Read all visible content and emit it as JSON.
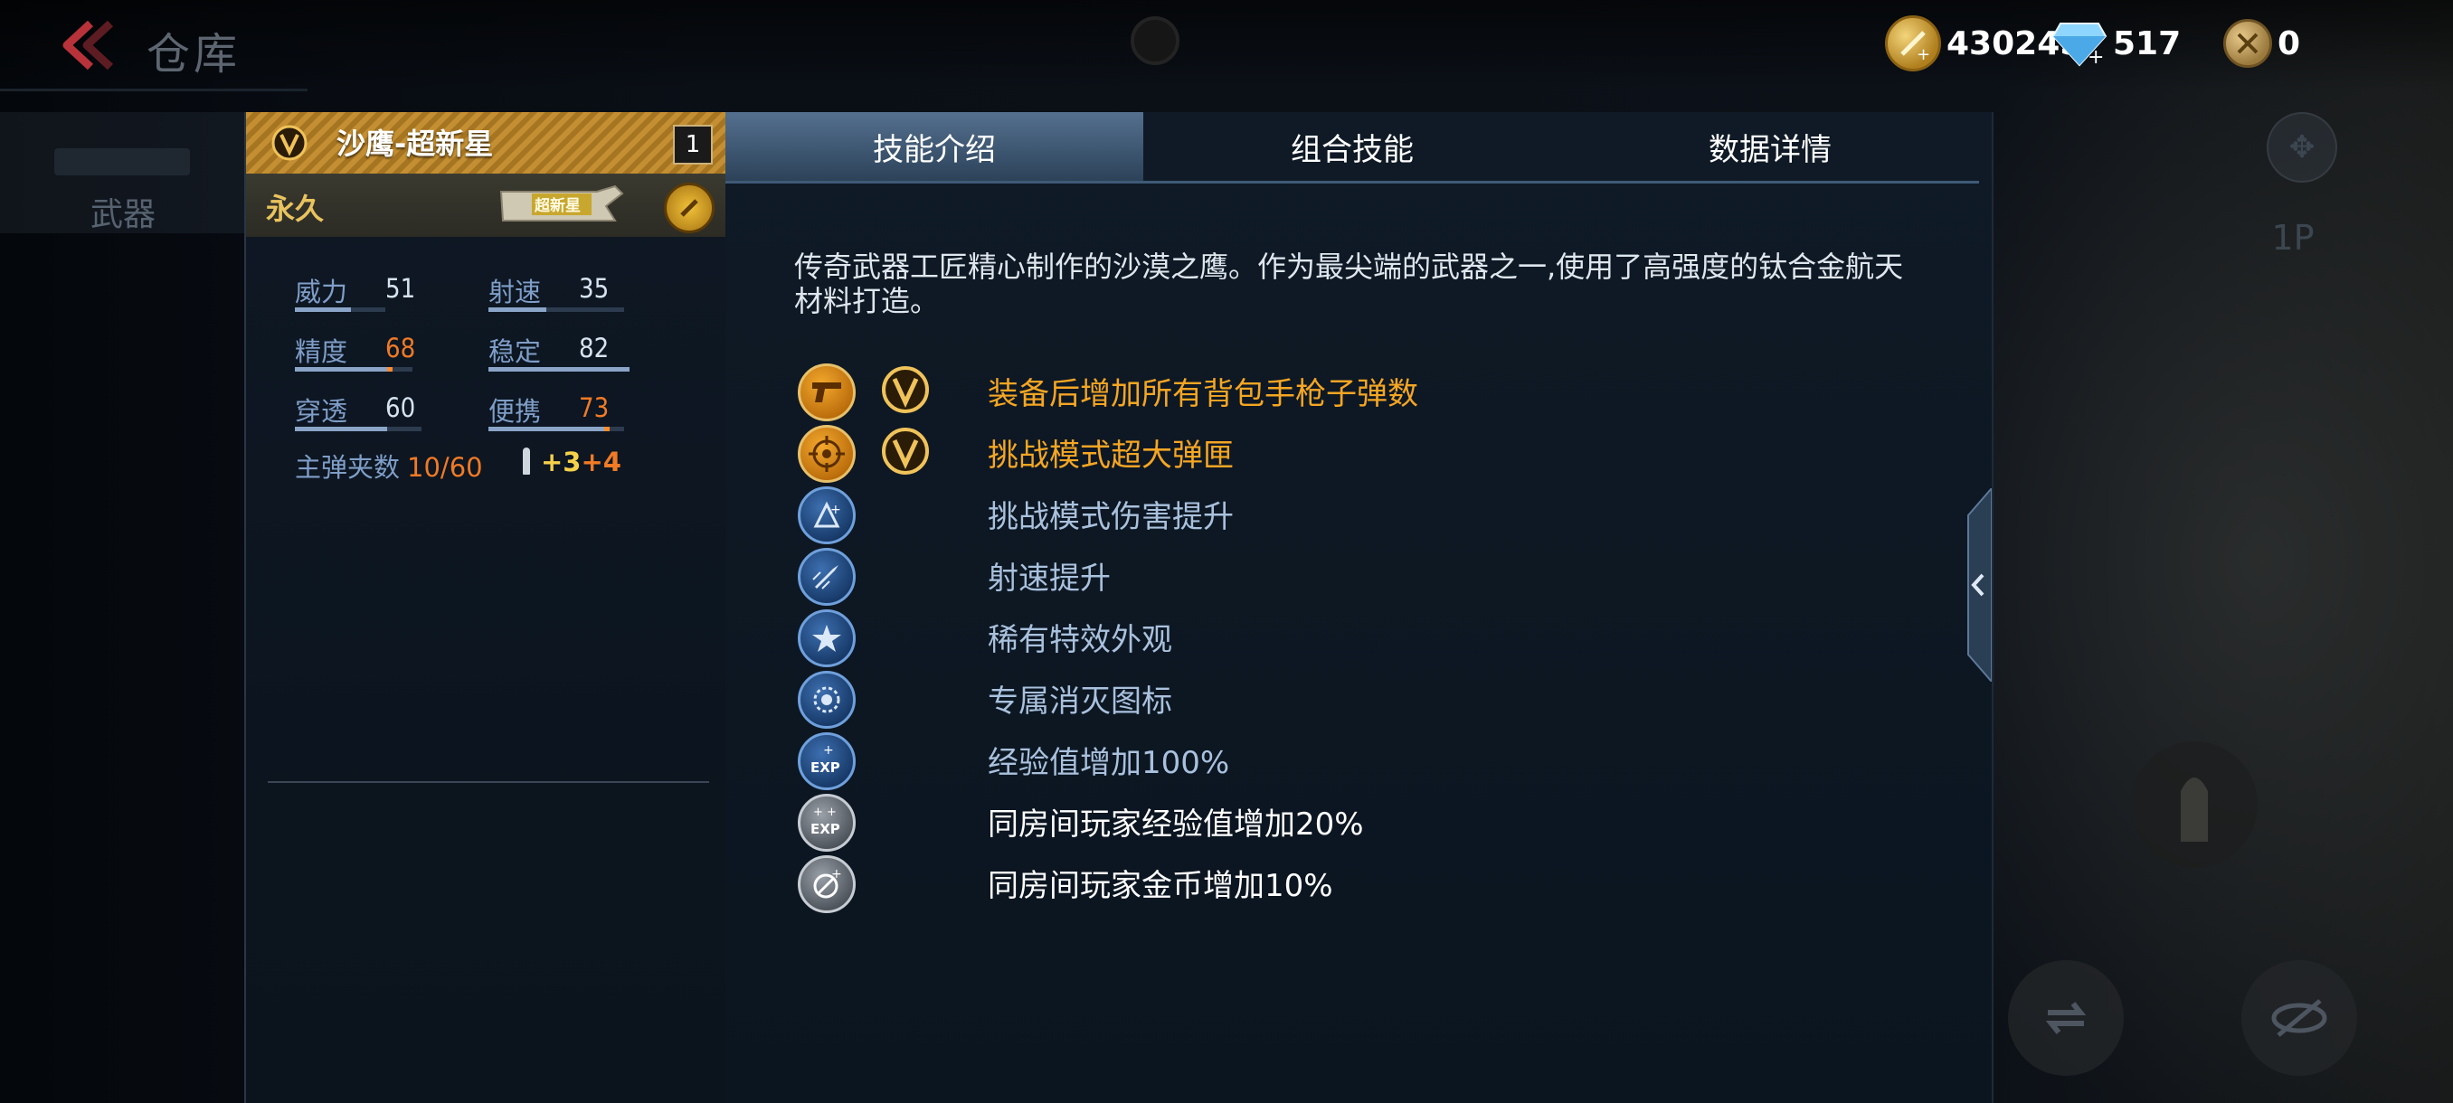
{
  "header": {
    "title": "仓库"
  },
  "nav": {
    "weapons_label": "武器"
  },
  "currency": {
    "gold": "430245",
    "diamond": "517",
    "token": "0"
  },
  "weapon": {
    "name": "沙鹰-超新星",
    "count": "1",
    "duration": "永久",
    "tag": "超新星",
    "stats": {
      "power": {
        "label": "威力",
        "value": "51",
        "level": 0.51
      },
      "fire_rate": {
        "label": "射速",
        "value": "35",
        "level": 0.35
      },
      "accuracy": {
        "label": "精度",
        "value": "68",
        "level": 0.68
      },
      "stability": {
        "label": "稳定",
        "value": "82",
        "level": 0.82
      },
      "penetration": {
        "label": "穿透",
        "value": "60",
        "level": 0.6
      },
      "portability": {
        "label": "便携",
        "value": "73",
        "level": 0.73
      }
    },
    "ammo_label": "主弹夹数",
    "ammo_value": "10/60",
    "ammo_bonus_a": "+3",
    "ammo_bonus_b": "+4"
  },
  "tabs": [
    "技能介绍",
    "组合技能",
    "数据详情"
  ],
  "active_tab": 0,
  "description": "传奇武器工匠精心制作的沙漠之鹰。作为最尖端的武器之一,使用了高强度的钛合金航天材料打造。",
  "skills": [
    {
      "text": "装备后增加所有背包手枪子弹数",
      "icon": "pistol-icon",
      "color": "#f5a623"
    },
    {
      "text": "挑战模式超大弹匣",
      "icon": "target-icon",
      "color": "#f5a623"
    },
    {
      "text": "挑战模式伤害提升",
      "icon": "damage-boost-icon",
      "color": "#a9c1dd"
    },
    {
      "text": "射速提升",
      "icon": "bullet-speed-icon",
      "color": "#a9c1dd"
    },
    {
      "text": "稀有特效外观",
      "icon": "star-icon",
      "color": "#a9c1dd"
    },
    {
      "text": "专属消灭图标",
      "icon": "kill-icon",
      "color": "#a9c1dd"
    },
    {
      "text": "经验值增加100%",
      "icon": "exp-icon",
      "color": "#a9c1dd"
    },
    {
      "text": "同房间玩家经验值增加20%",
      "icon": "room-exp-icon",
      "color": "#ffffff"
    },
    {
      "text": "同房间玩家金币增加10%",
      "icon": "room-coin-icon",
      "color": "#ffffff"
    }
  ],
  "colors": {
    "accent_gold": "#f5a623",
    "accent_orange": "#f07a26",
    "tab_active": "#54708f",
    "header_gold": "#c48f32"
  },
  "side": {
    "p1_label": "1P"
  }
}
